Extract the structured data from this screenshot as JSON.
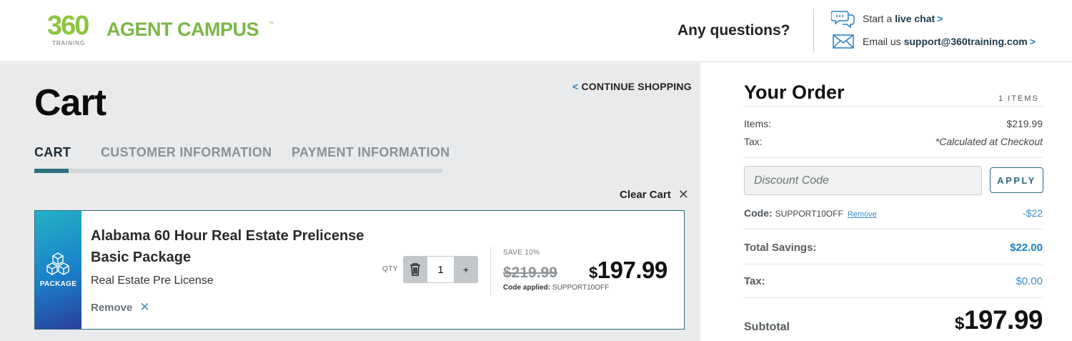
{
  "header": {
    "logo": {
      "number": "360",
      "sub": "TRAINING",
      "name": "AGENT CAMPUS",
      "tm": "™"
    },
    "questions": "Any questions?",
    "chat": {
      "prefix": "Start a",
      "link": "live chat",
      "arrow": ">"
    },
    "email": {
      "prefix": "Email us",
      "link": "support@360training.com",
      "arrow": ">"
    }
  },
  "cart": {
    "title": "Cart",
    "continue_arrow": "<",
    "continue_label": "CONTINUE SHOPPING",
    "steps": [
      "CART",
      "CUSTOMER INFORMATION",
      "PAYMENT INFORMATION"
    ],
    "active_step": 0,
    "clear_label": "Clear Cart",
    "clear_icon": "✕",
    "item": {
      "badge": "PACKAGE",
      "name": "Alabama 60 Hour Real Estate Prelicense Basic Package",
      "category": "Real Estate Pre License",
      "remove_label": "Remove",
      "remove_icon": "✕",
      "qty_label": "QTY",
      "qty": "1",
      "plus": "+",
      "save_label": "SAVE 10%",
      "old_price": "$219.99",
      "currency": "$",
      "new_price": "197.99",
      "code_applied_label": "Code applied:",
      "code_applied_value": "SUPPORT10OFF"
    }
  },
  "order": {
    "title": "Your Order",
    "items_count": "1 ITEMS",
    "items_label": "Items:",
    "items_value": "$219.99",
    "tax_label": "Tax:",
    "tax_value": "*Calculated at Checkout",
    "discount_placeholder": "Discount Code",
    "apply_label": "APPLY",
    "code_label": "Code:",
    "code_value": "SUPPORT10OFF",
    "code_remove": "Remove",
    "code_amount": "-$22",
    "savings_label": "Total Savings:",
    "savings_value": "$22.00",
    "tax2_label": "Tax:",
    "tax2_value": "$0.00",
    "subtotal_label": "Subtotal",
    "subtotal_currency": "$",
    "subtotal_value": "197.99"
  },
  "colors": {
    "brand_green": "#7ab648",
    "brand_teal": "#2d6a80",
    "link_blue": "#1e7fc2",
    "panel_gray": "#e8eaeb"
  }
}
